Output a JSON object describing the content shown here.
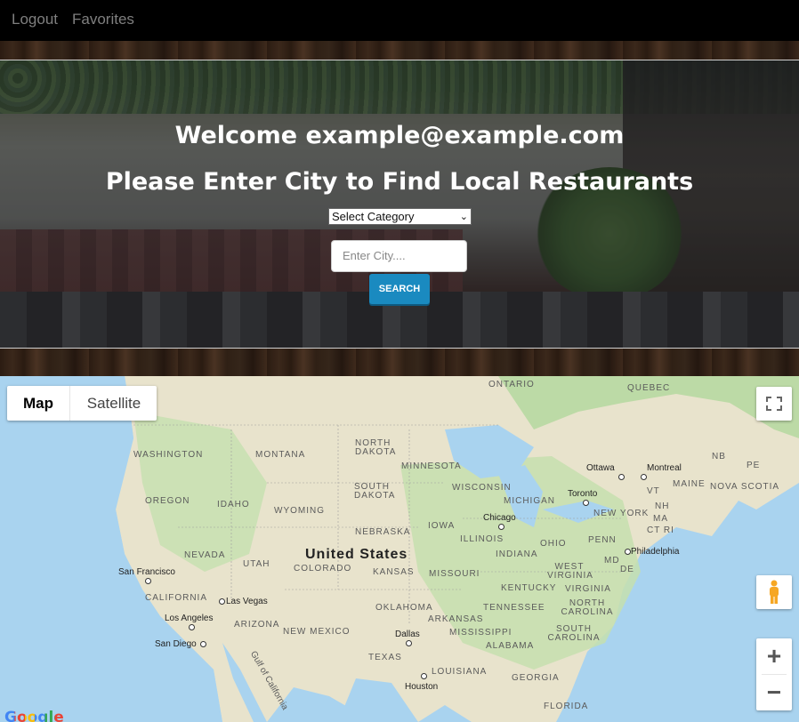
{
  "nav": {
    "logout": "Logout",
    "favorites": "Favorites"
  },
  "hero": {
    "welcome": "Welcome example@example.com",
    "prompt": "Please Enter City to Find Local Restaurants",
    "category_selected": "Select Category",
    "city_placeholder": "Enter City....",
    "search_label": "SEARCH"
  },
  "map": {
    "map_type": {
      "map": "Map",
      "satellite": "Satellite"
    },
    "country": "United States",
    "regions": [
      "ONTARIO",
      "QUEBEC",
      "WASHINGTON",
      "MONTANA",
      "NORTH DAKOTA",
      "MINNESOTA",
      "OREGON",
      "IDAHO",
      "WYOMING",
      "SOUTH DAKOTA",
      "WISCONSIN",
      "MICHIGAN",
      "NEVADA",
      "UTAH",
      "COLORADO",
      "NEBRASKA",
      "KANSAS",
      "IOWA",
      "ILLINOIS",
      "INDIANA",
      "OHIO",
      "PENN",
      "MISSOURI",
      "KENTUCKY",
      "WEST VIRGINIA",
      "VIRGINIA",
      "CALIFORNIA",
      "ARIZONA",
      "NEW MEXICO",
      "OKLAHOMA",
      "ARKANSAS",
      "TENNESSEE",
      "NORTH CAROLINA",
      "SOUTH CAROLINA",
      "MISSISSIPPI",
      "ALABAMA",
      "TEXAS",
      "LOUISIANA",
      "FLORIDA",
      "GEORGIA",
      "NB",
      "PE",
      "MAINE",
      "NOVA SCOTIA",
      "VT",
      "NH",
      "MA",
      "CT RI",
      "MD",
      "DE",
      "NEW YORK",
      "Gulf of California"
    ],
    "cities": [
      "Ottawa",
      "Montreal",
      "Toronto",
      "Chicago",
      "Philadelphia",
      "San Francisco",
      "Las Vegas",
      "Los Angeles",
      "San Diego",
      "Dallas",
      "Houston"
    ],
    "attribution": "Google"
  },
  "colors": {
    "nav_bg": "#000000",
    "search_button": "#1a8ac0",
    "water": "#a9d3ef",
    "land": "#e5e0c8",
    "green": "#b9d9a4"
  }
}
